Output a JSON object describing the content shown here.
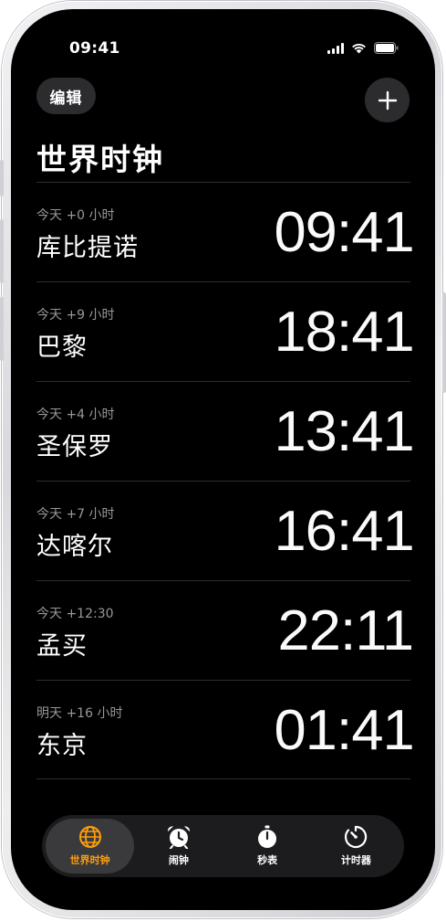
{
  "status_bar": {
    "time": "09:41"
  },
  "header": {
    "edit_label": "编辑",
    "title": "世界时钟"
  },
  "clocks": [
    {
      "offset": "今天 +0 小时",
      "city": "库比提诺",
      "time": "09:41"
    },
    {
      "offset": "今天 +9 小时",
      "city": "巴黎",
      "time": "18:41"
    },
    {
      "offset": "今天 +4 小时",
      "city": "圣保罗",
      "time": "13:41"
    },
    {
      "offset": "今天 +7 小时",
      "city": "达喀尔",
      "time": "16:41"
    },
    {
      "offset": "今天 +12:30",
      "city": "孟买",
      "time": "22:11"
    },
    {
      "offset": "明天 +16 小时",
      "city": "东京",
      "time": "01:41"
    }
  ],
  "tabs": [
    {
      "label": "世界时钟",
      "icon": "globe-icon",
      "active": true
    },
    {
      "label": "闹钟",
      "icon": "alarm-clock-icon",
      "active": false
    },
    {
      "label": "秒表",
      "icon": "stopwatch-icon",
      "active": false
    },
    {
      "label": "计时器",
      "icon": "timer-icon",
      "active": false
    }
  ],
  "colors": {
    "background": "#000000",
    "accent": "#ff9f0a",
    "secondary_text": "#98989d",
    "button_bg": "#2c2c2e"
  }
}
